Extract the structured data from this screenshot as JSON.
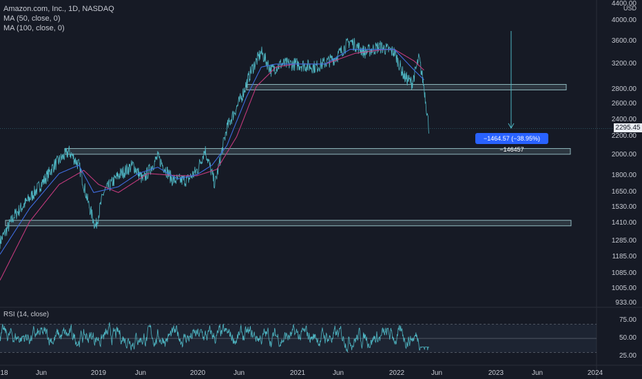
{
  "legend": {
    "symbol": "Amazon.com, Inc., 1D, NASDAQ",
    "ma50": "MA (50, close, 0)",
    "ma100": "MA (100, close, 0)",
    "rsi": "RSI (14, close)"
  },
  "price_axis": {
    "currency": "USD",
    "ticks": [
      "4000.00",
      "3600.00",
      "3200.00",
      "2800.00",
      "2600.00",
      "2400.00",
      "2200.00",
      "2000.00",
      "1800.00",
      "1650.00",
      "1530.00",
      "1410.00",
      "1285.00",
      "1185.00",
      "1085.00",
      "1005.00",
      "933.00"
    ],
    "top_tick": "4400.00",
    "current_price": "2295.45"
  },
  "rsi_axis": {
    "ticks": [
      "75.00",
      "50.00",
      "25.00"
    ]
  },
  "time_axis": {
    "ticks": [
      "18",
      "Jun",
      "2019",
      "Jun",
      "2020",
      "Jun",
      "2021",
      "Jun",
      "2022",
      "Jun",
      "2023",
      "Jun",
      "2024"
    ]
  },
  "measure_tool": {
    "label": "−1464.57 (−38.95%) −146457"
  },
  "colors": {
    "background": "#161a25",
    "price": "#4fb7c4",
    "ma50": "#3f6de0",
    "ma100": "#c2397c",
    "zone": "#8fb7bd",
    "measure": "#2962ff"
  },
  "chart_data": {
    "type": "line",
    "scale": "log",
    "series": [
      {
        "name": "Amazon.com, Inc., 1D, NASDAQ",
        "anchors": [
          [
            2018.0,
            1280
          ],
          [
            2018.15,
            1470
          ],
          [
            2018.3,
            1600
          ],
          [
            2018.45,
            1760
          ],
          [
            2018.55,
            1900
          ],
          [
            2018.7,
            2040
          ],
          [
            2018.8,
            1900
          ],
          [
            2018.9,
            1550
          ],
          [
            2018.97,
            1380
          ],
          [
            2019.05,
            1650
          ],
          [
            2019.2,
            1800
          ],
          [
            2019.35,
            1900
          ],
          [
            2019.45,
            1760
          ],
          [
            2019.6,
            1980
          ],
          [
            2019.75,
            1760
          ],
          [
            2019.9,
            1760
          ],
          [
            2020.0,
            1850
          ],
          [
            2020.08,
            2060
          ],
          [
            2020.18,
            1720
          ],
          [
            2020.3,
            2300
          ],
          [
            2020.45,
            2700
          ],
          [
            2020.55,
            3100
          ],
          [
            2020.65,
            3400
          ],
          [
            2020.75,
            3100
          ],
          [
            2020.85,
            3200
          ],
          [
            2021.0,
            3200
          ],
          [
            2021.2,
            3150
          ],
          [
            2021.4,
            3300
          ],
          [
            2021.55,
            3600
          ],
          [
            2021.7,
            3400
          ],
          [
            2021.85,
            3500
          ],
          [
            2022.0,
            3400
          ],
          [
            2022.1,
            3000
          ],
          [
            2022.18,
            2900
          ],
          [
            2022.25,
            3300
          ],
          [
            2022.3,
            2850
          ],
          [
            2022.35,
            2300
          ]
        ]
      },
      {
        "name": "MA (50, close, 0)",
        "anchors": [
          [
            2018.0,
            1200
          ],
          [
            2018.3,
            1520
          ],
          [
            2018.6,
            1820
          ],
          [
            2018.8,
            1900
          ],
          [
            2018.95,
            1650
          ],
          [
            2019.2,
            1700
          ],
          [
            2019.4,
            1820
          ],
          [
            2019.6,
            1880
          ],
          [
            2019.8,
            1770
          ],
          [
            2020.0,
            1810
          ],
          [
            2020.15,
            1900
          ],
          [
            2020.3,
            2100
          ],
          [
            2020.5,
            2700
          ],
          [
            2020.65,
            3150
          ],
          [
            2020.8,
            3200
          ],
          [
            2021.0,
            3200
          ],
          [
            2021.3,
            3200
          ],
          [
            2021.55,
            3450
          ],
          [
            2021.8,
            3450
          ],
          [
            2022.0,
            3450
          ],
          [
            2022.2,
            3100
          ],
          [
            2022.3,
            2950
          ]
        ]
      },
      {
        "name": "MA (100, close, 0)",
        "anchors": [
          [
            2018.0,
            1050
          ],
          [
            2018.3,
            1420
          ],
          [
            2018.6,
            1720
          ],
          [
            2018.85,
            1850
          ],
          [
            2019.0,
            1720
          ],
          [
            2019.2,
            1650
          ],
          [
            2019.5,
            1820
          ],
          [
            2019.8,
            1800
          ],
          [
            2020.0,
            1800
          ],
          [
            2020.2,
            1860
          ],
          [
            2020.4,
            2200
          ],
          [
            2020.6,
            2850
          ],
          [
            2020.8,
            3150
          ],
          [
            2021.0,
            3200
          ],
          [
            2021.3,
            3200
          ],
          [
            2021.6,
            3380
          ],
          [
            2021.9,
            3450
          ],
          [
            2022.0,
            3450
          ],
          [
            2022.2,
            3250
          ],
          [
            2022.3,
            3100
          ]
        ]
      }
    ],
    "zones": [
      {
        "from": 2800,
        "to": 2880
      },
      {
        "from": 2010,
        "to": 2070
      },
      {
        "from": 1390,
        "to": 1430
      }
    ],
    "current_price": 2295.45,
    "rsi": {
      "name": "RSI (14, close)",
      "upper": 70,
      "mid": 50,
      "lower": 30,
      "range": [
        20,
        85
      ]
    }
  }
}
